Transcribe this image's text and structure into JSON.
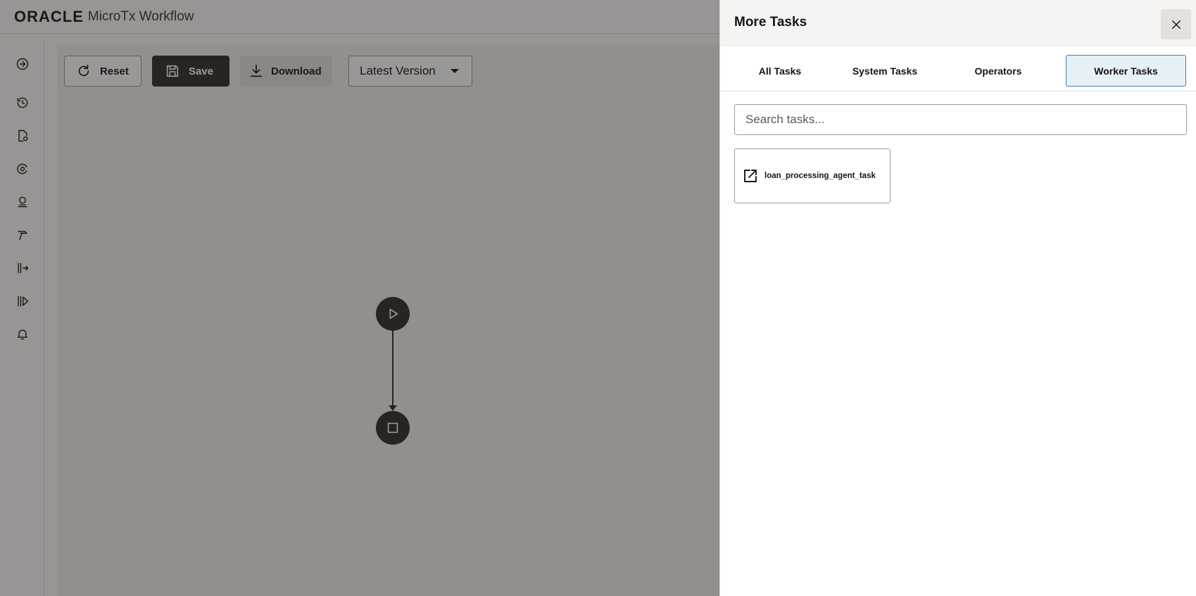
{
  "app": {
    "brand": "ORACLE",
    "product": "MicroTx Workflow"
  },
  "sidebar": {
    "icons": [
      "expand-arrow-icon",
      "history-icon",
      "document-settings-icon",
      "sync-icon",
      "agent-icon",
      "hammer-icon",
      "export-icon",
      "run-icon",
      "bell-icon"
    ]
  },
  "toolbar": {
    "reset_label": "Reset",
    "save_label": "Save",
    "download_label": "Download",
    "version_selected": "Latest Version"
  },
  "drawer": {
    "title": "More Tasks",
    "tabs": [
      {
        "label": "All Tasks",
        "active": false
      },
      {
        "label": "System Tasks",
        "active": false
      },
      {
        "label": "Operators",
        "active": false
      },
      {
        "label": "Worker Tasks",
        "active": true
      }
    ],
    "search_placeholder": "Search tasks...",
    "search_value": "",
    "tasks": [
      {
        "label": "loan_processing_agent_task",
        "icon": "external-link-icon"
      }
    ]
  },
  "colors": {
    "dark_button": "#312d2a",
    "active_tab_bg": "#e6f0f7",
    "active_tab_border": "#4a7fa6",
    "overlay": "rgba(30,27,24,0.45)"
  }
}
